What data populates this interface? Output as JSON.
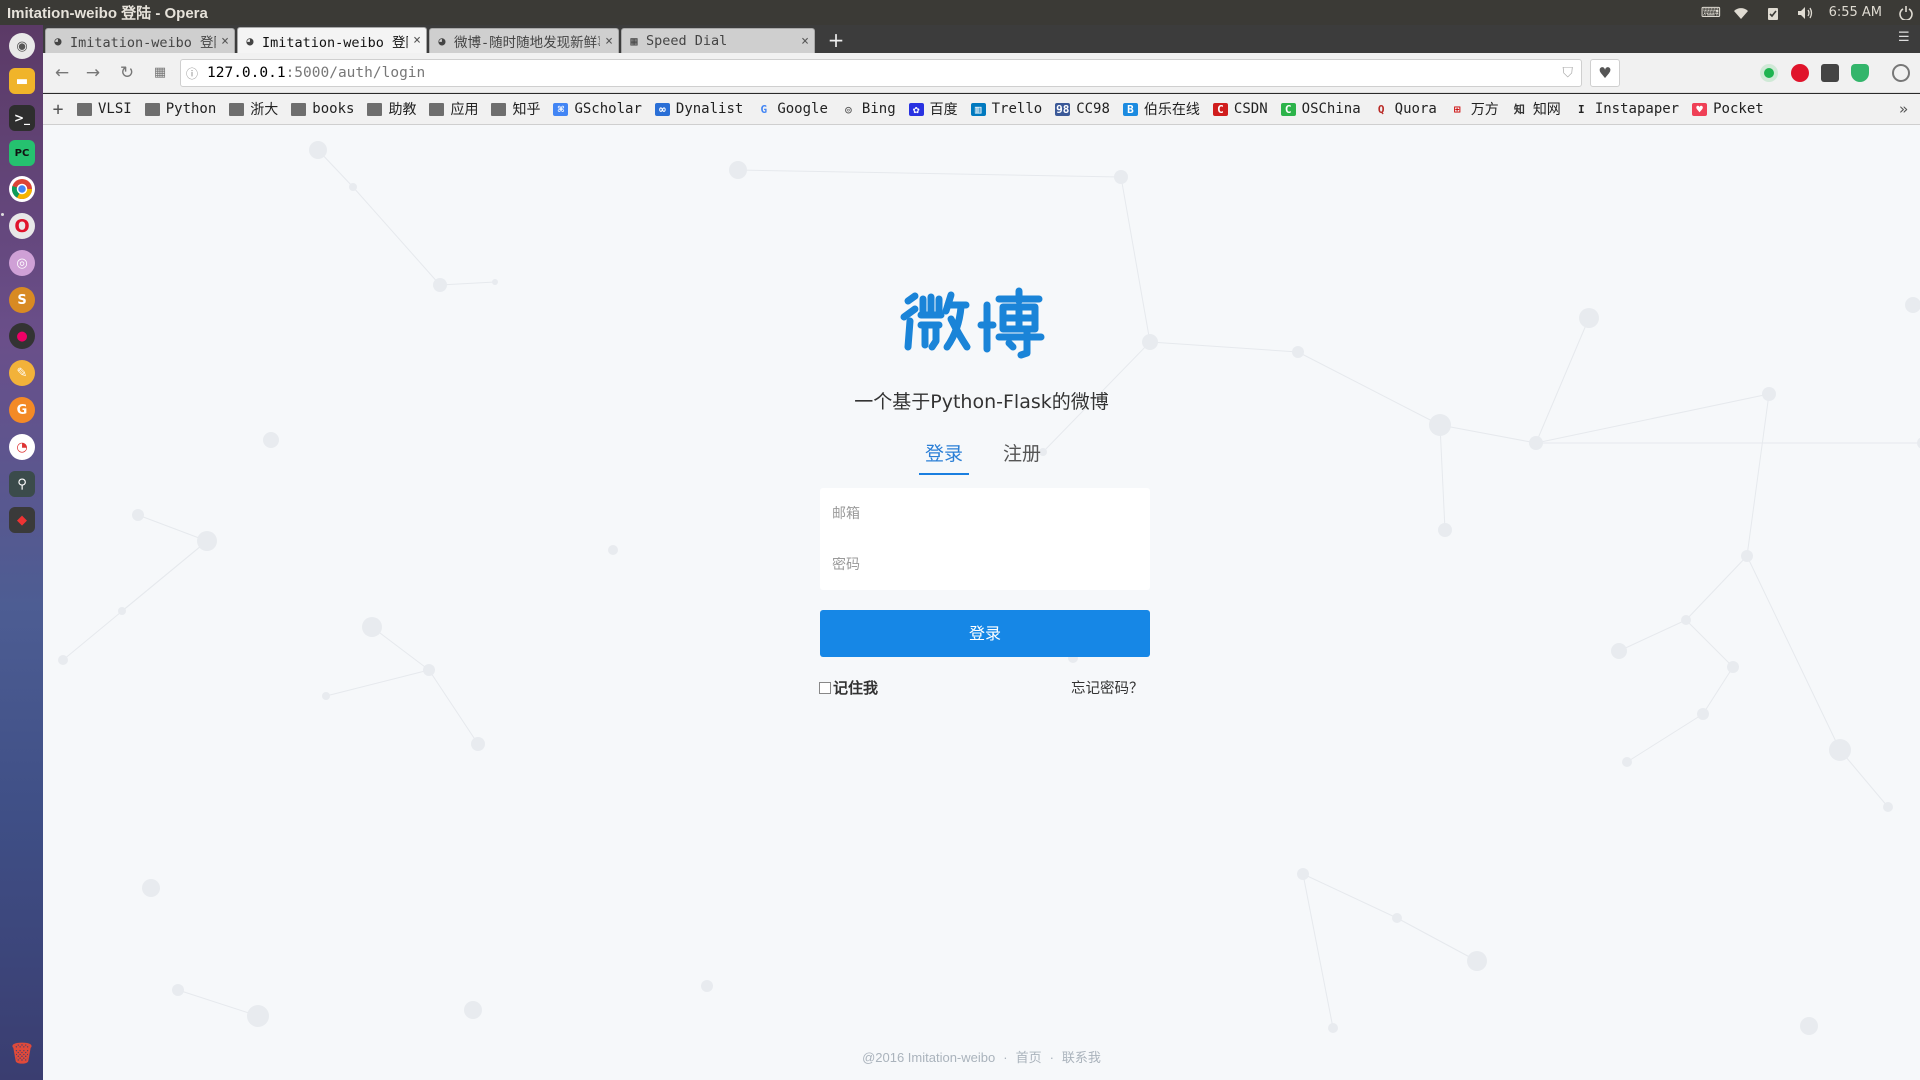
{
  "window": {
    "title": "Imitation-weibo 登陆 - Opera"
  },
  "system_tray": {
    "clock": "6:55 AM"
  },
  "tabs": [
    {
      "title": "Imitation-weibo 登陆",
      "active": false,
      "close": "×"
    },
    {
      "title": "Imitation-weibo 登陆",
      "active": true,
      "close": "×"
    },
    {
      "title": "微博-随时随地发现新鲜事",
      "active": false,
      "close": "×"
    },
    {
      "title": "Speed Dial",
      "active": false,
      "close": "×"
    }
  ],
  "new_tab_label": "+",
  "address_bar": {
    "host": "127.0.0.1",
    "path": ":5000/auth/login"
  },
  "bookmarks": {
    "add_label": "+",
    "items": [
      {
        "label": "VLSI",
        "icon": "folder-icon"
      },
      {
        "label": "Python",
        "icon": "folder-icon"
      },
      {
        "label": "浙大",
        "icon": "folder-icon"
      },
      {
        "label": "books",
        "icon": "folder-icon"
      },
      {
        "label": "助教",
        "icon": "folder-icon"
      },
      {
        "label": "应用",
        "icon": "folder-icon"
      },
      {
        "label": "知乎",
        "icon": "folder-icon"
      },
      {
        "label": "GScholar",
        "icon": "gscholar-icon"
      },
      {
        "label": "Dynalist",
        "icon": "dynalist-icon"
      },
      {
        "label": "Google",
        "icon": "google-icon"
      },
      {
        "label": "Bing",
        "icon": "bing-icon"
      },
      {
        "label": "百度",
        "icon": "baidu-icon"
      },
      {
        "label": "Trello",
        "icon": "trello-icon"
      },
      {
        "label": "CC98",
        "icon": "cc98-icon"
      },
      {
        "label": "伯乐在线",
        "icon": "jobbole-icon"
      },
      {
        "label": "CSDN",
        "icon": "csdn-icon"
      },
      {
        "label": "OSChina",
        "icon": "oschina-icon"
      },
      {
        "label": "Quora",
        "icon": "quora-icon"
      },
      {
        "label": "万方",
        "icon": "wanfang-icon"
      },
      {
        "label": "知网",
        "icon": "cnki-icon"
      },
      {
        "label": "Instapaper",
        "icon": "instapaper-icon"
      },
      {
        "label": "Pocket",
        "icon": "pocket-icon"
      }
    ],
    "more_label": "»"
  },
  "page": {
    "logo_text": "微博",
    "tagline": "一个基于Python-Flask的微博",
    "tab_login": "登录",
    "tab_register": "注册",
    "email_placeholder": "邮箱",
    "password_placeholder": "密码",
    "login_button": "登录",
    "remember_me": "记住我",
    "forgot_password": "忘记密码？",
    "footer": {
      "copyright": "@2016 Imitation-weibo",
      "sep": "·",
      "home": "首页",
      "contact": "联系我"
    }
  },
  "colors": {
    "accent": "#1687e6",
    "background": "#f6f8fa",
    "tab_active": "#1a7fe0"
  }
}
